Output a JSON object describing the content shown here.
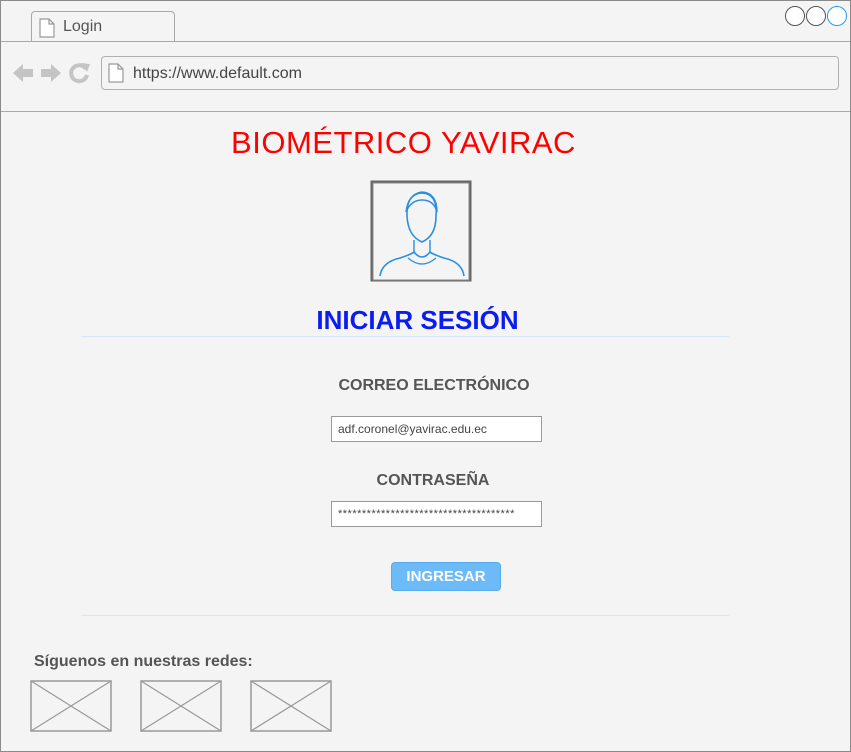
{
  "browser": {
    "tab_title": "Login",
    "url": "https://www.default.com",
    "accent_color": "#2a9bf0"
  },
  "page": {
    "title": "BIOMÉTRICO YAVIRAC",
    "title_color": "#ff0000",
    "login_title": "INICIAR SESIÓN",
    "login_title_color": "#0a1cf0",
    "avatar_icon": "user-avatar-icon",
    "email": {
      "label": "CORREO ELECTRÓNICO",
      "value": "adf.coronel@yavirac.edu.ec"
    },
    "password": {
      "label": "CONTRASEÑA",
      "value": "*************************************"
    },
    "submit_label": "INGRESAR",
    "button_color": "#6cbaf8",
    "social": {
      "label": "Síguenos en nuestras redes:",
      "items": [
        "social-image-placeholder",
        "social-image-placeholder",
        "social-image-placeholder"
      ]
    }
  }
}
